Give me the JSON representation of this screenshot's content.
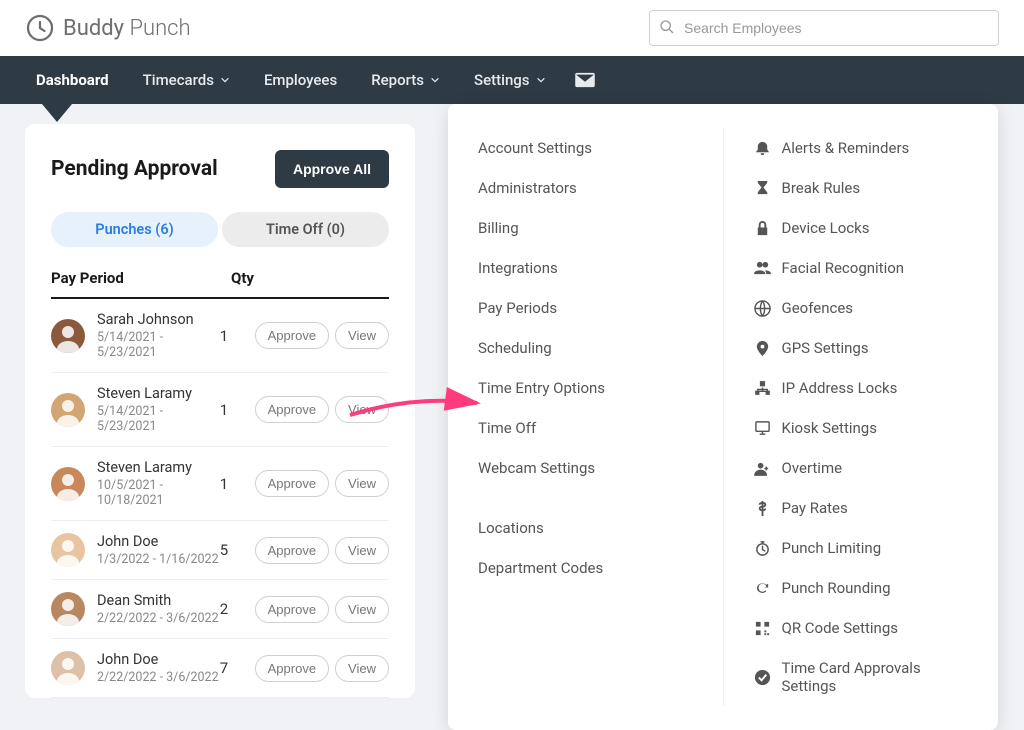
{
  "brand": {
    "part1": "Buddy",
    "part2": "Punch"
  },
  "search": {
    "placeholder": "Search Employees"
  },
  "nav": {
    "dashboard": "Dashboard",
    "timecards": "Timecards",
    "employees": "Employees",
    "reports": "Reports",
    "settings": "Settings"
  },
  "pending": {
    "title": "Pending Approval",
    "approve_all": "Approve All",
    "tab_punches": "Punches (6)",
    "tab_timeoff": "Time Off (0)",
    "col_period": "Pay Period",
    "col_qty": "Qty",
    "approve_btn": "Approve",
    "view_btn": "View",
    "rows": [
      {
        "name": "Sarah Johnson",
        "dates": "5/14/2021 - 5/23/2021",
        "qty": "1"
      },
      {
        "name": "Steven Laramy",
        "dates": "5/14/2021 - 5/23/2021",
        "qty": "1"
      },
      {
        "name": "Steven Laramy",
        "dates": "10/5/2021 - 10/18/2021",
        "qty": "1"
      },
      {
        "name": "John Doe",
        "dates": "1/3/2022 - 1/16/2022",
        "qty": "5"
      },
      {
        "name": "Dean Smith",
        "dates": "2/22/2022 - 3/6/2022",
        "qty": "2"
      },
      {
        "name": "John Doe",
        "dates": "2/22/2022 - 3/6/2022",
        "qty": "7"
      }
    ]
  },
  "settings_menu": {
    "left": [
      "Account Settings",
      "Administrators",
      "Billing",
      "Integrations",
      "Pay Periods",
      "Scheduling",
      "Time Entry Options",
      "Time Off",
      "Webcam Settings"
    ],
    "left2": [
      "Locations",
      "Department Codes"
    ],
    "right": [
      "Alerts & Reminders",
      "Break Rules",
      "Device Locks",
      "Facial Recognition",
      "Geofences",
      "GPS Settings",
      "IP Address Locks",
      "Kiosk Settings",
      "Overtime",
      "Pay Rates",
      "Punch Limiting",
      "Punch Rounding",
      "QR Code Settings",
      "Time Card Approvals Settings"
    ]
  },
  "avatar_colors": [
    "#8b5a3c",
    "#d4a574",
    "#c9885c",
    "#e8c5a0",
    "#b88860",
    "#dcc0a8"
  ],
  "right_icons": [
    "bell",
    "hourglass",
    "lock",
    "users",
    "globe",
    "pin",
    "network",
    "monitor",
    "person-plus",
    "dollar",
    "stopwatch",
    "refresh",
    "qr",
    "check-circle"
  ]
}
